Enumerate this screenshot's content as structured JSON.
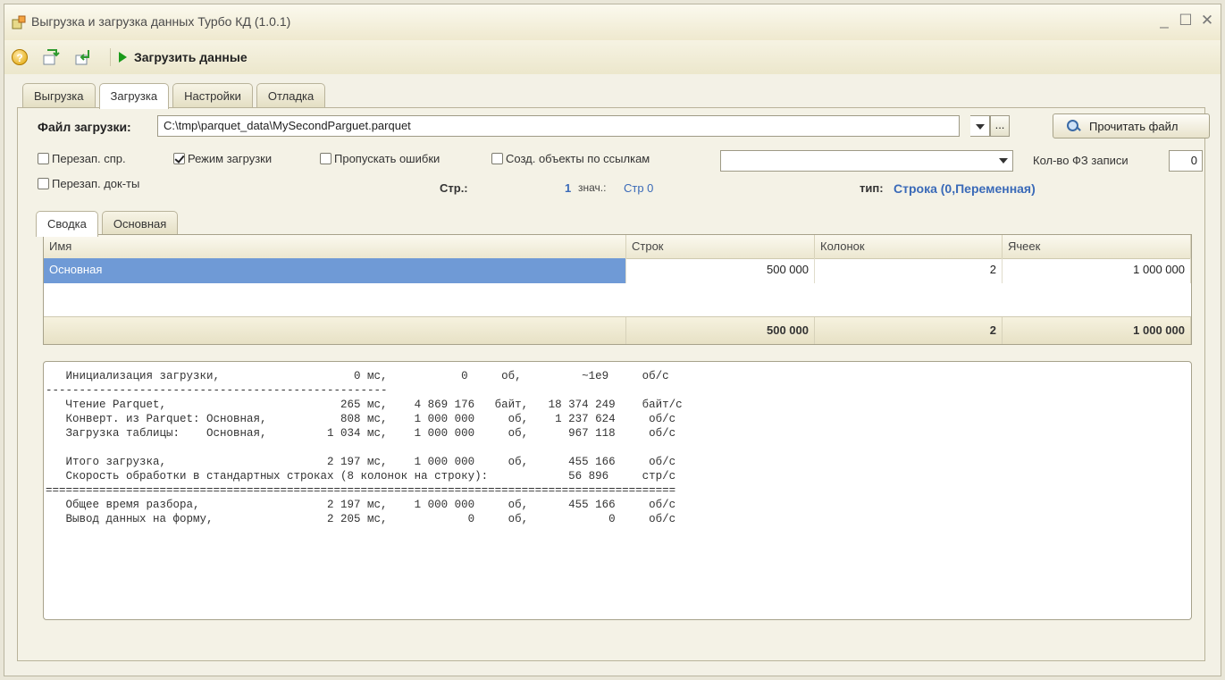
{
  "window": {
    "title": "Выгрузка и загрузка данных Турбо КД (1.0.1)",
    "minimize": "_",
    "maximize": "☐",
    "close": "✕"
  },
  "toolbar": {
    "help_glyph": "?",
    "load_label": "Загрузить данные"
  },
  "tabs_top": [
    {
      "label": "Выгрузка",
      "active": false
    },
    {
      "label": "Загрузка",
      "active": true
    },
    {
      "label": "Настройки",
      "active": false
    },
    {
      "label": "Отладка",
      "active": false
    }
  ],
  "file": {
    "label": "Файл загрузки:",
    "value": "C:\\tmp\\parquet_data\\MySecondParguet.parquet",
    "dots": "...",
    "read_button": "Прочитать файл"
  },
  "checks": [
    {
      "label": "Перезап. спр.",
      "checked": false
    },
    {
      "label": "Режим загрузки",
      "checked": true
    },
    {
      "label": "Пропускать ошибки",
      "checked": false
    },
    {
      "label": "Созд. объекты по ссылкам",
      "checked": false
    },
    {
      "label": "Перезап. док-ты",
      "checked": false
    }
  ],
  "combo2": {
    "value": ""
  },
  "kol": {
    "label": "Кол-во ФЗ записи",
    "value": "0"
  },
  "info": {
    "str_label": "Стр.:",
    "str_value": "1",
    "znach_label": "знач.:",
    "znach_value": "Стр 0",
    "tip_label": "тип:",
    "tip_value": "Строка (0,Переменная)"
  },
  "tabs_inner": [
    {
      "label": "Сводка",
      "active": true
    },
    {
      "label": "Основная",
      "active": false
    }
  ],
  "grid": {
    "headers": [
      "Имя",
      "Строк",
      "Колонок",
      "Ячеек"
    ],
    "rows": [
      [
        "Основная",
        "500 000",
        "2",
        "1 000 000"
      ]
    ],
    "totals": [
      "",
      "500 000",
      "2",
      "1 000 000"
    ]
  },
  "log": {
    "lines": [
      "   Инициализация загрузки,                    0 мс,           0     об,         ~1е9     об/с",
      "---------------------------------------------------",
      "   Чтение Parquet,                          265 мс,    4 869 176   байт,   18 374 249    байт/с",
      "   Конверт. из Parquet: Основная,           808 мс,    1 000 000     об,    1 237 624     об/с",
      "   Загрузка таблицы:    Основная,         1 034 мс,    1 000 000     об,      967 118     об/с",
      "",
      "   Итого загрузка,                        2 197 мс,    1 000 000     об,      455 166     об/с",
      "   Скорость обработки в стандартных строках (8 колонок на строку):            56 896     стр/с",
      "==============================================================================================",
      "   Общее время разбора,                   2 197 мс,    1 000 000     об,      455 166     об/с",
      "   Вывод данных на форму,                 2 205 мс,            0     об,            0     об/с"
    ]
  }
}
